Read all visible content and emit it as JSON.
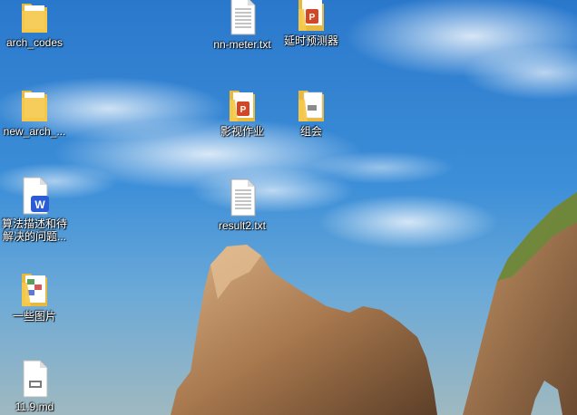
{
  "desktop": {
    "icons": [
      {
        "label": "arch_codes",
        "type": "folder"
      },
      {
        "label": "new_arch_...",
        "type": "folder"
      },
      {
        "label": "算法描述和待解决的问题...",
        "type": "word-document"
      },
      {
        "label": "一些图片",
        "type": "folder-images"
      },
      {
        "label": "11.9.md",
        "type": "markdown-file"
      },
      {
        "label": "nn-meter.txt",
        "type": "text-file"
      },
      {
        "label": "影视作业",
        "type": "folder-powerpoint"
      },
      {
        "label": "result2.txt",
        "type": "text-file"
      },
      {
        "label": "延时预测器",
        "type": "folder-powerpoint"
      },
      {
        "label": "组会",
        "type": "folder-documents"
      }
    ]
  },
  "colors": {
    "folder_yellow": "#f5c94c",
    "word_blue": "#2b5cd6",
    "powerpoint_red": "#d24726"
  }
}
